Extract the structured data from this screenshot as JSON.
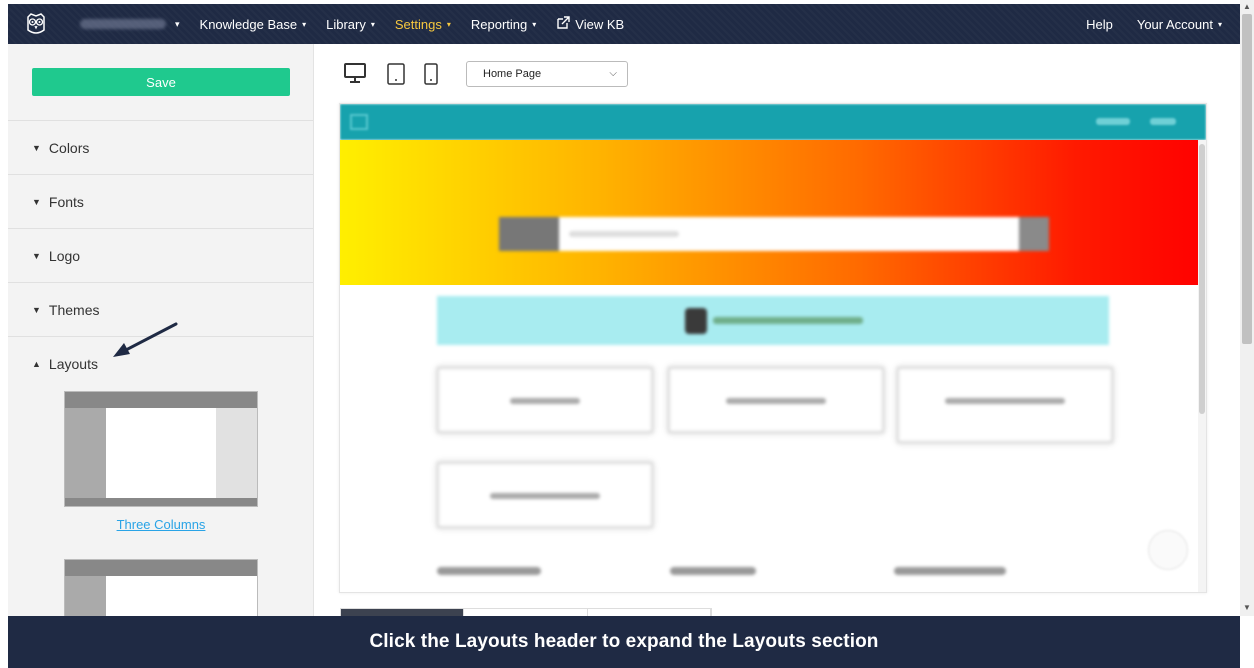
{
  "nav": {
    "items": [
      {
        "label": "Knowledge Base"
      },
      {
        "label": "Library"
      },
      {
        "label": "Settings",
        "active": true
      },
      {
        "label": "Reporting"
      },
      {
        "label": "View KB"
      }
    ],
    "help": "Help",
    "account": "Your Account"
  },
  "sidebar": {
    "save_label": "Save",
    "sections": [
      {
        "label": "Colors",
        "expanded": false
      },
      {
        "label": "Fonts",
        "expanded": false
      },
      {
        "label": "Logo",
        "expanded": false
      },
      {
        "label": "Themes",
        "expanded": false
      },
      {
        "label": "Layouts",
        "expanded": true
      }
    ],
    "layouts": [
      {
        "label": "Three Columns"
      }
    ]
  },
  "toolbar": {
    "devices": [
      "desktop-icon",
      "tablet-icon",
      "phone-icon"
    ],
    "page_select": "Home Page"
  },
  "caption": "Click the Layouts header to expand the Layouts section",
  "colors": {
    "nav_bg": "#1f2a44",
    "save_btn": "#1fc98e",
    "active_nav": "#f6c83f",
    "link": "#29a3e6"
  }
}
